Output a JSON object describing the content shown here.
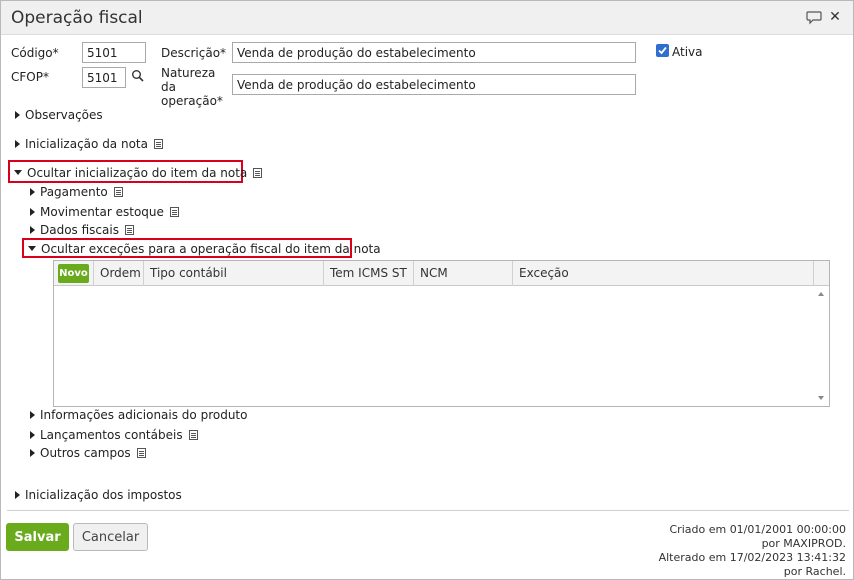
{
  "window": {
    "title": "Operação fiscal"
  },
  "icons": {
    "chat": "speech-bubble-icon",
    "close": "close-icon",
    "search": "magnifier-icon",
    "doc": "document-icon"
  },
  "form": {
    "codigo_label": "Código*",
    "codigo_value": "5101",
    "descricao_label": "Descrição*",
    "descricao_value": "Venda de produção do estabelecimento",
    "ativa_label": "Ativa",
    "ativa_checked": true,
    "cfop_label": "CFOP*",
    "cfop_value": "5101",
    "natureza_label_1": "Natureza",
    "natureza_label_2": "da",
    "natureza_label_3": "operação*",
    "natureza_value": "Venda de produção do estabelecimento"
  },
  "sections": {
    "observacoes": "Observações",
    "inicializacao_nota": "Inicialização da nota",
    "ocultar_item": "Ocultar inicialização do item da nota",
    "pagamento": "Pagamento",
    "movimentar_estoque": "Movimentar estoque",
    "dados_fiscais": "Dados fiscais",
    "ocultar_excecoes": "Ocultar exceções para a operação fiscal do item da nota",
    "info_adicionais": "Informações adicionais do produto",
    "lancamentos": "Lançamentos contábeis",
    "outros_campos": "Outros campos",
    "inicializacao_impostos": "Inicialização dos impostos"
  },
  "grid": {
    "novo_label": "Novo",
    "columns": [
      "Ordem",
      "Tipo contábil",
      "Tem ICMS ST",
      "NCM",
      "Exceção"
    ]
  },
  "buttons": {
    "save": "Salvar",
    "cancel": "Cancelar"
  },
  "audit": {
    "created": "Criado em 01/01/2001 00:00:00",
    "created_by": "por MAXIPROD.",
    "altered": "Alterado em 17/02/2023 13:41:32",
    "altered_by": "por Rachel."
  },
  "colors": {
    "accent_green": "#6aaa1d",
    "highlight_red": "#d9001b",
    "checkbox_blue": "#2f6fd0"
  }
}
